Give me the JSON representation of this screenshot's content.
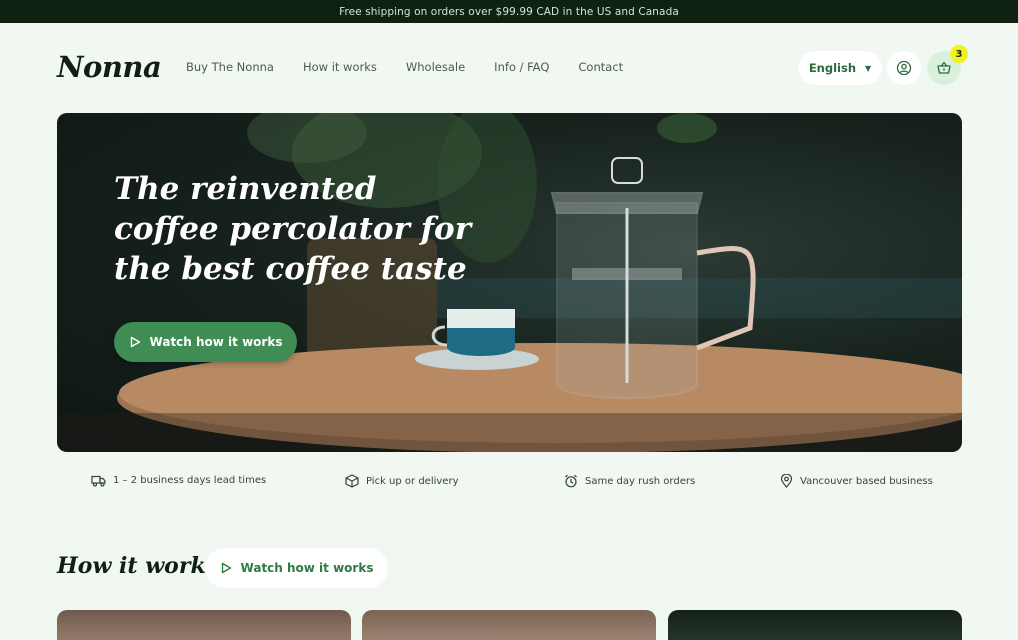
{
  "announcement": "Free shipping on orders over $99.99 CAD in the US and Canada",
  "brand": "Nonna",
  "nav": {
    "items": [
      {
        "label": "Buy The Nonna"
      },
      {
        "label": "How it works"
      },
      {
        "label": "Wholesale"
      },
      {
        "label": "Info / FAQ"
      },
      {
        "label": "Contact"
      }
    ]
  },
  "header": {
    "language": "English",
    "cart_count": "3"
  },
  "hero": {
    "title": "The reinvented coffee percolator for the best coffee taste",
    "cta": "Watch how it works"
  },
  "features": [
    {
      "label": "1 – 2 business days lead times",
      "icon": "truck-icon"
    },
    {
      "label": "Pick up or delivery",
      "icon": "box-icon"
    },
    {
      "label": "Same day rush orders",
      "icon": "alarm-clock-icon"
    },
    {
      "label": "Vancouver based business",
      "icon": "map-pin-icon"
    }
  ],
  "how_it_works": {
    "title": "How it works",
    "cta": "Watch how it works"
  },
  "colors": {
    "announcement_bg": "#0f2212",
    "accent_green": "#3f8d55",
    "page_bg": "#f1f8f2",
    "cart_badge": "#f3f21a"
  }
}
